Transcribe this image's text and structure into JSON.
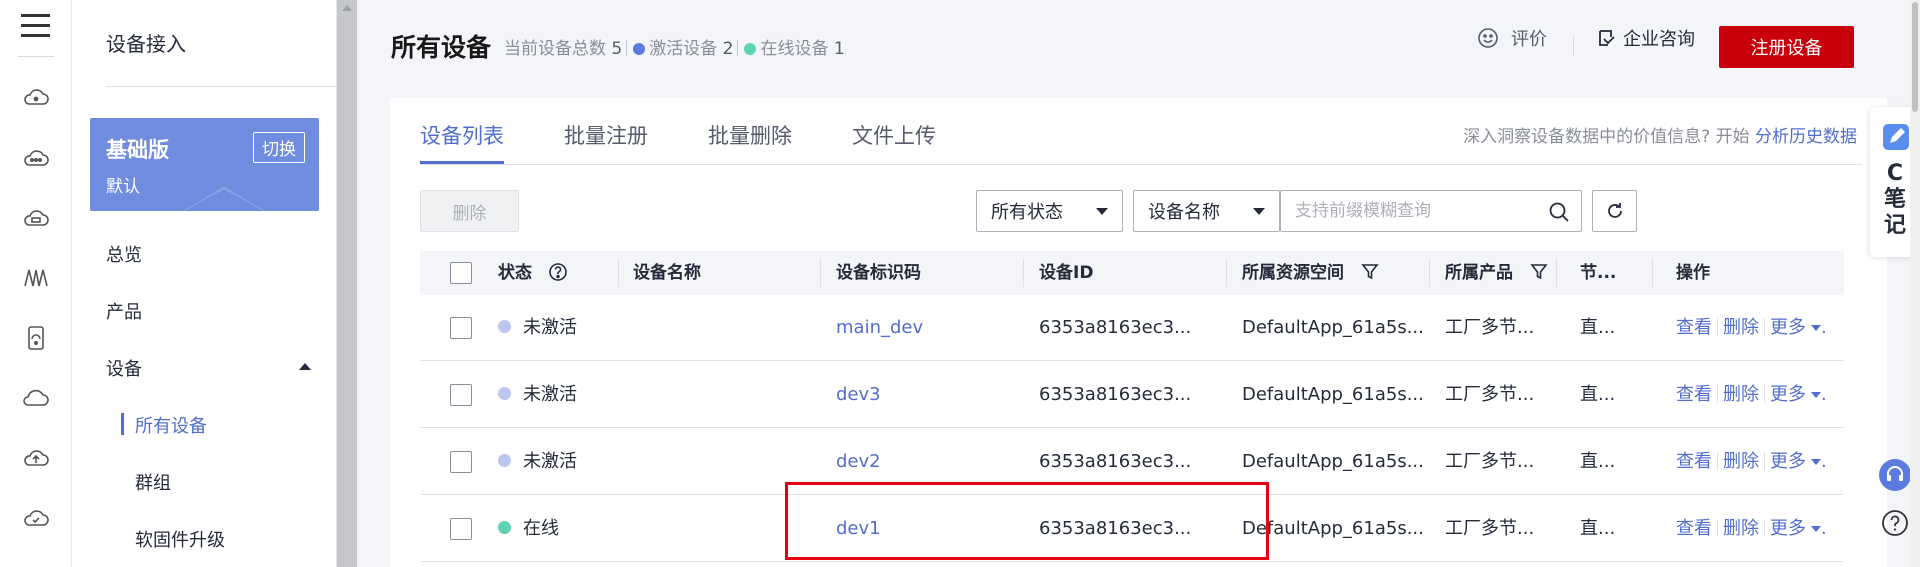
{
  "rail": {
    "icons": [
      "menu-icon",
      "cloud-dot-icon",
      "cloud-dots-icon",
      "cloud-box-icon",
      "wave-icon",
      "device-icon",
      "cloud-icon",
      "cloud-upload-icon",
      "cloud-check-icon",
      "cloud-down-icon"
    ]
  },
  "subnav": {
    "service_title": "设备接入",
    "edition": {
      "name": "基础版",
      "sub": "默认",
      "switch_label": "切换"
    },
    "items": [
      {
        "label": "总览"
      },
      {
        "label": "产品"
      },
      {
        "label": "设备"
      }
    ],
    "device_children": [
      {
        "label": "所有设备",
        "active": true
      },
      {
        "label": "群组"
      },
      {
        "label": "软固件升级"
      }
    ]
  },
  "header": {
    "title": "所有设备",
    "summary_label": "当前设备总数",
    "total": "5",
    "activated_label": "激活设备",
    "activated": "2",
    "online_label": "在线设备",
    "online": "1",
    "colors": {
      "activated": "#5b7be0",
      "online": "#5fd3b5"
    },
    "rate_label": "评价",
    "consult_label": "企业咨询",
    "register_label": "注册设备"
  },
  "tabs": [
    {
      "label": "设备列表",
      "active": true
    },
    {
      "label": "批量注册"
    },
    {
      "label": "批量删除"
    },
    {
      "label": "文件上传"
    }
  ],
  "insight": {
    "text": "深入洞察设备数据中的价值信息?  开始",
    "link": "分析历史数据"
  },
  "toolbar": {
    "delete_label": "删除",
    "status_select": "所有状态",
    "field_select": "设备名称",
    "search_placeholder": "支持前缀模糊查询"
  },
  "table": {
    "columns": [
      "状态",
      "设备名称",
      "设备标识码",
      "设备ID",
      "所属资源空间",
      "所属产品",
      "节...",
      "操作"
    ],
    "rows": [
      {
        "status": "未激活",
        "status_color": "#bcc6f0",
        "name": "",
        "node_id": "main_dev",
        "device_id": "6353a8163ec3...",
        "space": "DefaultApp_61a5s...",
        "product": "工厂多节...",
        "node": "直...",
        "op_view": "查看",
        "op_delete": "删除",
        "op_more": "更多"
      },
      {
        "status": "未激活",
        "status_color": "#bcc6f0",
        "name": "",
        "node_id": "dev3",
        "device_id": "6353a8163ec3...",
        "space": "DefaultApp_61a5s...",
        "product": "工厂多节...",
        "node": "直...",
        "op_view": "查看",
        "op_delete": "删除",
        "op_more": "更多"
      },
      {
        "status": "未激活",
        "status_color": "#bcc6f0",
        "name": "",
        "node_id": "dev2",
        "device_id": "6353a8163ec3...",
        "space": "DefaultApp_61a5s...",
        "product": "工厂多节...",
        "node": "直...",
        "op_view": "查看",
        "op_delete": "删除",
        "op_more": "更多"
      },
      {
        "status": "在线",
        "status_color": "#5fd3b5",
        "name": "",
        "node_id": "dev1",
        "device_id": "6353a8163ec3...",
        "space": "DefaultApp_61a5s...",
        "product": "工厂多节...",
        "node": "直...",
        "op_view": "查看",
        "op_delete": "删除",
        "op_more": "更多"
      }
    ]
  },
  "float": {
    "note_letter": "C",
    "note_text1": "笔",
    "note_text2": "记"
  },
  "colors": {
    "brand_red": "#c7000b",
    "primary_blue": "#526ecc",
    "highlight_red": "#e60012"
  }
}
